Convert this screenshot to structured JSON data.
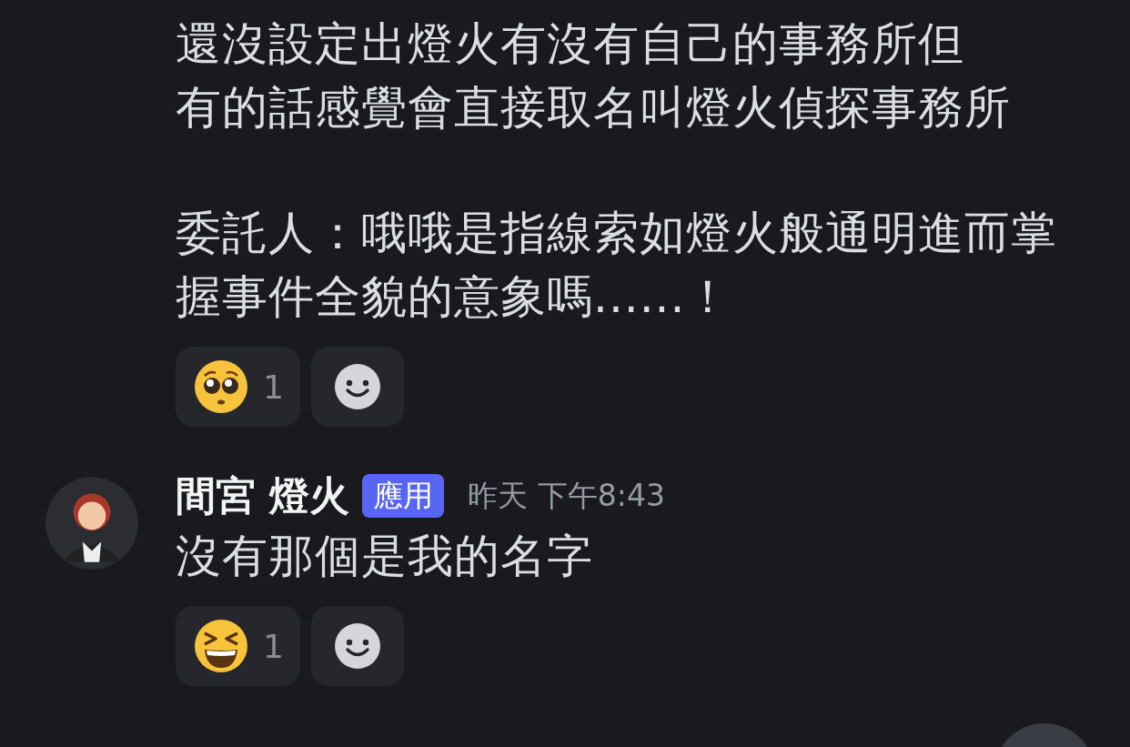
{
  "messages": [
    {
      "kind": "continuation",
      "paragraphs": [
        [
          "還沒設定出燈火有沒有自己的事務所但",
          "有的話感覺會直接取名叫燈火偵探事務所"
        ],
        [
          "委託人：哦哦是指線索如燈火般通明進而掌",
          "握事件全貌的意象嗎......！"
        ]
      ],
      "reactions": [
        {
          "kind": "pleading",
          "count": "1"
        }
      ]
    },
    {
      "kind": "full",
      "author": "間宮 燈火",
      "badge": "應用",
      "timestamp": "昨天 下午8:43",
      "text": "沒有那個是我的名字",
      "reactions": [
        {
          "kind": "squint",
          "count": "1"
        }
      ]
    }
  ]
}
